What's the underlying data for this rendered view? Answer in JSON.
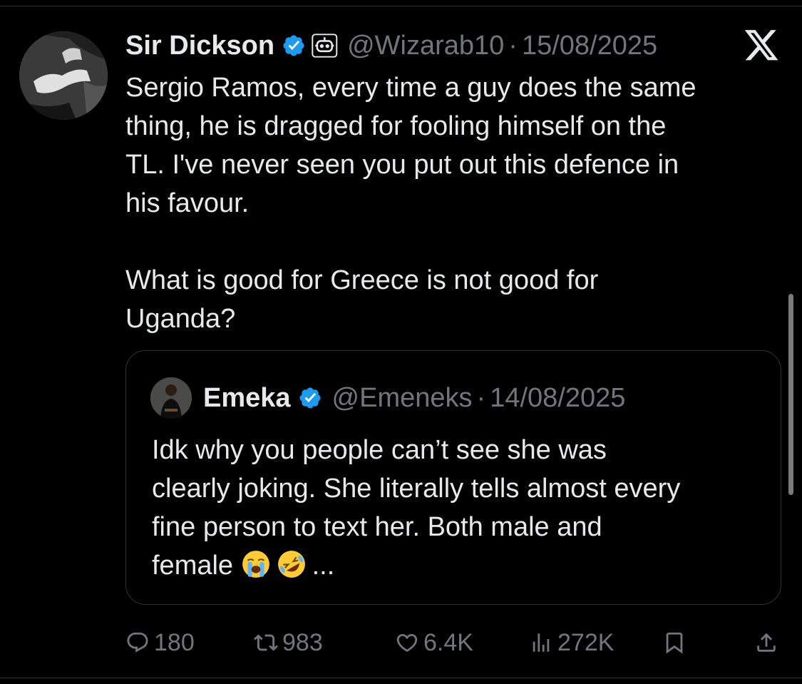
{
  "tweet": {
    "author_name": "Sir Dickson",
    "handle": "@Wizarab10",
    "separator": "·",
    "date": "15/08/2025",
    "text_lines": [
      "Sergio Ramos, every time a guy does the same",
      "thing, he is dragged for fooling himself on the",
      "TL. I've never seen you put out this defence in",
      "his favour."
    ],
    "text_para2_lines": [
      "What is good for Greece is not good for",
      "Uganda?"
    ]
  },
  "quoted": {
    "author_name": "Emeka",
    "handle": "@Emeneks",
    "separator": "·",
    "date": "14/08/2025",
    "text_lines": [
      "Idk why you people can’t see she was",
      "clearly joking. She literally tells almost every",
      "fine person to text her. Both male and"
    ],
    "last_line_text": "female",
    "emojis": [
      "loudly-crying-face-emoji",
      "rolling-on-floor-laughing-emoji"
    ],
    "ellipsis": "..."
  },
  "actions": {
    "replies": "180",
    "reposts": "983",
    "likes": "6.4K",
    "views": "272K"
  },
  "icons": {
    "verified": "verified-badge-icon",
    "bot": "automated-account-icon",
    "logo": "x-logo-icon",
    "reply": "reply-icon",
    "repost": "repost-icon",
    "like": "heart-icon",
    "views": "views-icon",
    "bookmark": "bookmark-icon",
    "share": "share-icon"
  },
  "colors": {
    "background": "#000000",
    "text_primary": "#e7e9ea",
    "text_secondary": "#71767b",
    "verified_blue": "#1d9bf0",
    "border": "#2f3336"
  }
}
